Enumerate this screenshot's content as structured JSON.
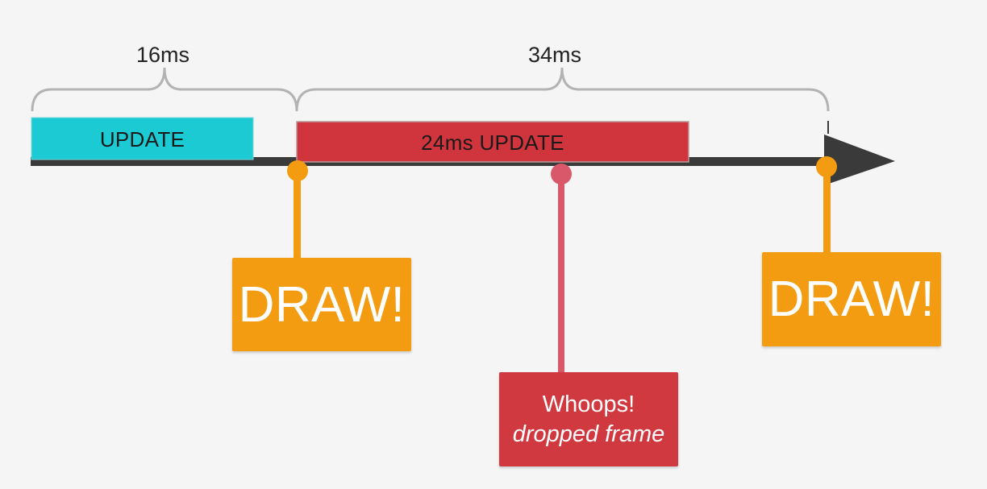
{
  "intervals": {
    "first": "16ms",
    "second": "34ms"
  },
  "timeline": {
    "update_label": "UPDATE",
    "long_update_label": "24ms UPDATE"
  },
  "callouts": {
    "draw_1": "DRAW!",
    "draw_2": "DRAW!",
    "dropped_title": "Whoops!",
    "dropped_subtitle": "dropped frame"
  },
  "colors": {
    "background": "#f5f5f5",
    "update_bar": "#1ccad4",
    "long_update_bar": "#d0343c",
    "draw": "#f39c12",
    "dropped": "#d0393f",
    "dropped_stem": "#d9596a",
    "axis": "#3a3a3a",
    "bracket": "#b3b3b3"
  }
}
